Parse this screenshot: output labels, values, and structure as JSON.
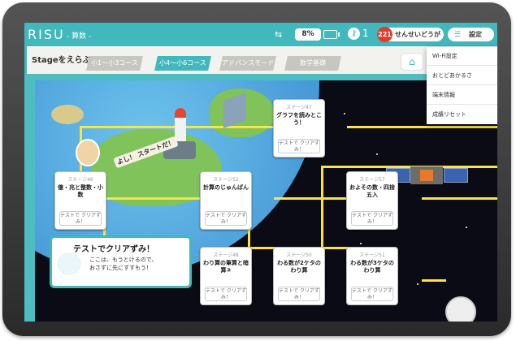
{
  "topbar": {
    "logo": "RISU",
    "subject": "- 算数 -",
    "battery_percent": "8%",
    "key_count": "1",
    "notification_count": "221",
    "teacher_button": "せんせいどうが",
    "settings_button": "設定"
  },
  "header": {
    "title": "Stageをえらぶ",
    "tabs": [
      {
        "label": "小1〜小3コース",
        "active": false
      },
      {
        "label": "小4〜小6コース",
        "active": true
      },
      {
        "label": "アドバンスモード",
        "active": false
      },
      {
        "label": "数学基礎",
        "active": false
      }
    ]
  },
  "settings_menu": {
    "items": [
      "Wi-Fi設定",
      "おとどあかるさ",
      "端末情報",
      "成績リセット"
    ]
  },
  "map": {
    "sign_text": "よし！ スタートだ！",
    "stages": [
      {
        "label": "ステージ47",
        "name": "グラフを読みとこう！",
        "button": "テストで クリアずみ！"
      },
      {
        "label": "ステージ46",
        "name": "億・兆と整数・小数",
        "button": "テストで クリアずみ！"
      },
      {
        "label": "ステージ52",
        "name": "計算のじゅんばん",
        "button": "テストで クリアずみ！"
      },
      {
        "label": "ステージ57",
        "name": "およその数・四捨五入",
        "button": "テストで クリアずみ！"
      },
      {
        "label": "ステージ48",
        "name": "わり算の筆算と暗算②",
        "button": "テストで クリアずみ！"
      },
      {
        "label": "ステージ50",
        "name": "わる数が2ケタのわり算",
        "button": "テストで クリアずみ！"
      },
      {
        "label": "ステージ51",
        "name": "わる数が3ケタのわり算",
        "button": "テストで クリアずみ！"
      }
    ]
  },
  "tooltip": {
    "title": "テストでクリアずみ！",
    "line1": "ここは、もうとけるので、",
    "line2": "おさずに先にすすもう！"
  },
  "colors": {
    "accent": "#41b8bc",
    "track": "#ffe23a",
    "badge": "#e23b2a"
  }
}
